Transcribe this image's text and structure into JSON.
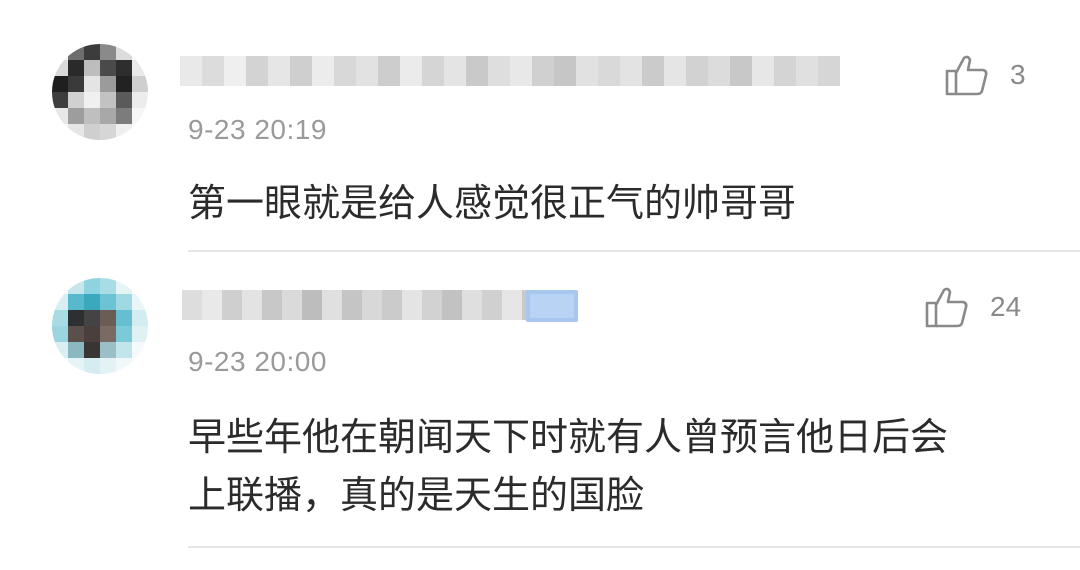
{
  "comments": [
    {
      "avatar_icon": "blurred-avatar",
      "username": "",
      "timestamp": "9-23 20:19",
      "text": "第一眼就是给人感觉很正气的帅哥哥",
      "like_icon": "thumbs-up-icon",
      "like_count": "3"
    },
    {
      "avatar_icon": "blurred-avatar",
      "username": "",
      "timestamp": "9-23 20:00",
      "text_line1": "早些年他在朝闻天下时就有人曾预言他日后会",
      "text_line2": "上联播，真的是天生的国脸",
      "like_icon": "thumbs-up-icon",
      "like_count": "24"
    }
  ],
  "colors": {
    "text": "#2b2b2b",
    "meta": "#9a9a9a",
    "divider": "#e6e6e6",
    "badge": "#a9c7ee"
  }
}
